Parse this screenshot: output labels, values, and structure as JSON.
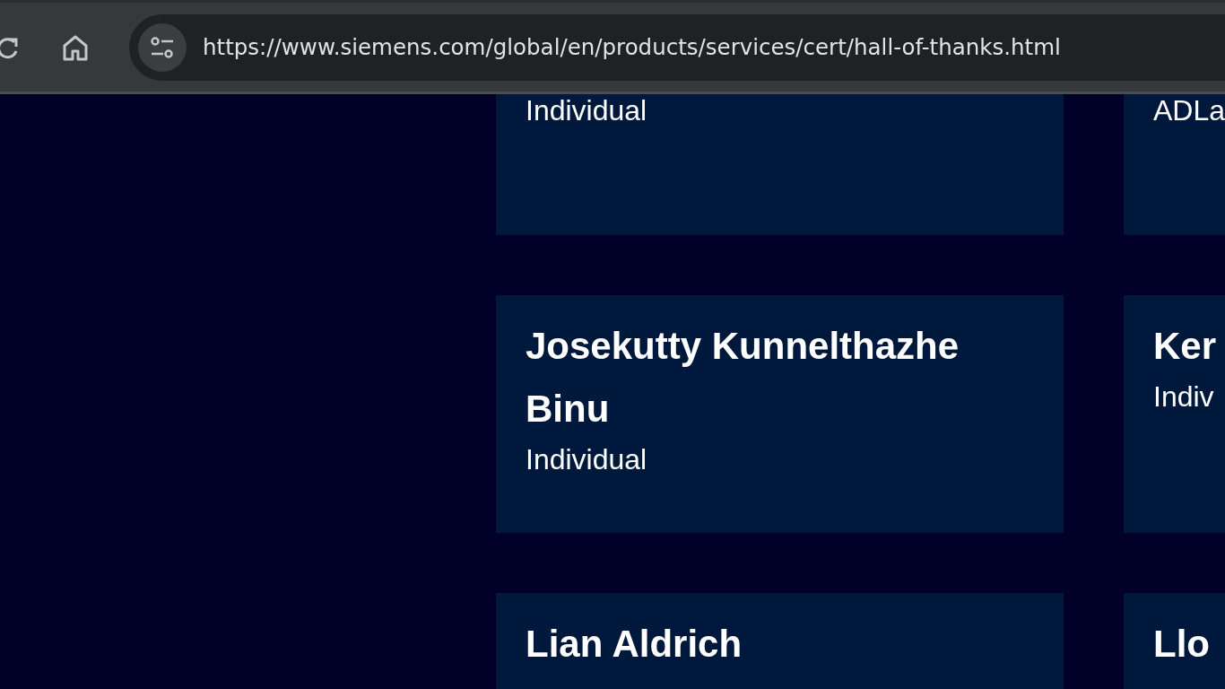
{
  "toolbar": {
    "url": "https://www.siemens.com/global/en/products/services/cert/hall-of-thanks.html"
  },
  "rows": [
    {
      "cards": [
        {
          "type": "Individual"
        },
        {
          "type": "ADLa"
        }
      ]
    },
    {
      "cards": [
        {
          "name": "Josekutty Kunnelthazhe Binu",
          "type": "Individual"
        },
        {
          "name": "Ker",
          "type": "Indiv"
        }
      ]
    },
    {
      "cards": [
        {
          "name": "Lian Aldrich"
        },
        {
          "name": "Llo"
        }
      ]
    }
  ]
}
